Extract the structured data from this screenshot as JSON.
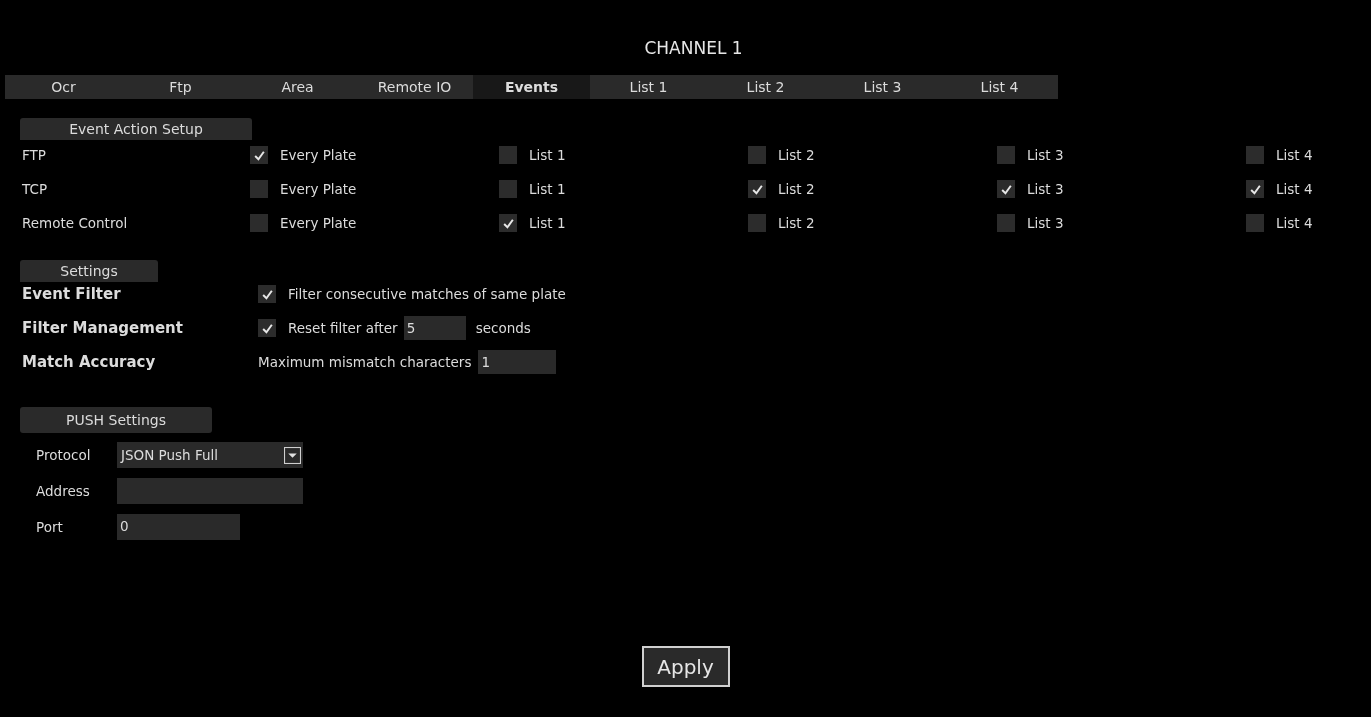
{
  "window": {
    "title": "CHANNEL 1"
  },
  "tabs": [
    {
      "label": "Ocr",
      "selected": false
    },
    {
      "label": "Ftp",
      "selected": false
    },
    {
      "label": "Area",
      "selected": false
    },
    {
      "label": "Remote IO",
      "selected": false
    },
    {
      "label": "Events",
      "selected": true
    },
    {
      "label": "List 1",
      "selected": false
    },
    {
      "label": "List 2",
      "selected": false
    },
    {
      "label": "List 3",
      "selected": false
    },
    {
      "label": "List 4",
      "selected": false
    }
  ],
  "event_action_setup": {
    "header": "Event Action Setup",
    "rows": [
      {
        "label": "FTP",
        "options": [
          {
            "label": "Every Plate",
            "checked": true
          },
          {
            "label": "List 1",
            "checked": false
          },
          {
            "label": "List 2",
            "checked": false
          },
          {
            "label": "List 3",
            "checked": false
          },
          {
            "label": "List 4",
            "checked": false
          }
        ]
      },
      {
        "label": "TCP",
        "options": [
          {
            "label": "Every Plate",
            "checked": false
          },
          {
            "label": "List 1",
            "checked": false
          },
          {
            "label": "List 2",
            "checked": true
          },
          {
            "label": "List 3",
            "checked": true
          },
          {
            "label": "List 4",
            "checked": true
          }
        ]
      },
      {
        "label": "Remote Control",
        "options": [
          {
            "label": "Every Plate",
            "checked": false
          },
          {
            "label": "List 1",
            "checked": true
          },
          {
            "label": "List 2",
            "checked": false
          },
          {
            "label": "List 3",
            "checked": false
          },
          {
            "label": "List 4",
            "checked": false
          }
        ]
      }
    ]
  },
  "settings": {
    "header": "Settings",
    "rows": [
      {
        "kind": "checkbox",
        "label": "Event Filter",
        "checked": true,
        "text": "Filter consecutive matches of same plate"
      },
      {
        "kind": "checkbox_number",
        "label": "Filter Management",
        "checked": true,
        "text": "Reset filter after",
        "value": "5",
        "suffix": "seconds"
      },
      {
        "kind": "number",
        "label": "Match Accuracy",
        "text": "Maximum mismatch characters",
        "value": "1"
      }
    ]
  },
  "push_settings": {
    "header": "PUSH Settings",
    "protocol": {
      "label": "Protocol",
      "value": "JSON Push Full"
    },
    "address": {
      "label": "Address"
    },
    "port": {
      "label": "Port",
      "value": "0"
    }
  },
  "apply_button": "Apply"
}
